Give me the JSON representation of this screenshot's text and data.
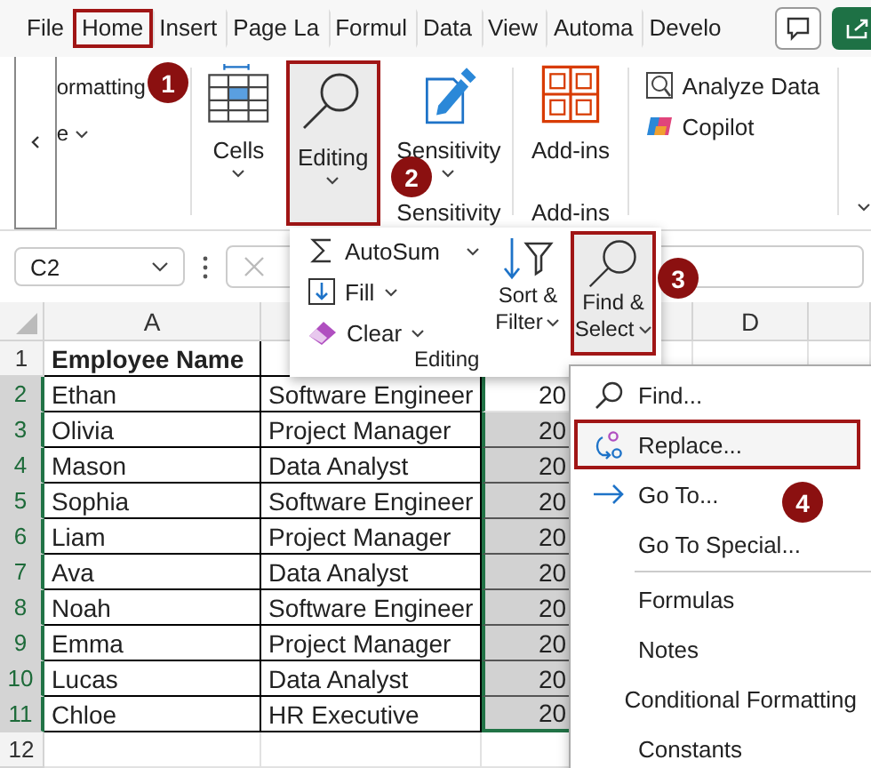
{
  "tabs": [
    {
      "label": "File",
      "selected": false
    },
    {
      "label": "Home",
      "selected": true
    },
    {
      "label": "Insert",
      "selected": false
    },
    {
      "label": "Page La",
      "selected": false
    },
    {
      "label": "Formul",
      "selected": false
    },
    {
      "label": "Data",
      "selected": false
    },
    {
      "label": "View",
      "selected": false
    },
    {
      "label": "Automa",
      "selected": false
    },
    {
      "label": "Develo",
      "selected": false
    }
  ],
  "ribbon": {
    "partial_group": {
      "line_1": "ormatting",
      "line_2": "e"
    },
    "cells": {
      "label": "Cells"
    },
    "editing": {
      "label": "Editing",
      "pressed": true
    },
    "sensitivity": {
      "label": "Sensitivity",
      "group_label": "Sensitivity"
    },
    "addins": {
      "label": "Add-ins",
      "group_label": "Add-ins"
    },
    "commands": [
      {
        "kind": "analyze",
        "label": "Analyze Data"
      },
      {
        "kind": "copilot",
        "label": "Copilot"
      }
    ]
  },
  "formula_bar": {
    "name_box": "C2"
  },
  "grid": {
    "column_headers": {
      "a": "A",
      "d": "D"
    },
    "header_row": {
      "number": "1",
      "name": "Employee Name"
    },
    "rows": [
      {
        "number": "2",
        "name": "Ethan",
        "role": "Software Engineer",
        "value": "20",
        "selected": true,
        "active": true
      },
      {
        "number": "3",
        "name": "Olivia",
        "role": "Project Manager",
        "value": "20",
        "selected": true,
        "active": false
      },
      {
        "number": "4",
        "name": "Mason",
        "role": "Data Analyst",
        "value": "20",
        "selected": true,
        "active": false
      },
      {
        "number": "5",
        "name": "Sophia",
        "role": "Software Engineer",
        "value": "20",
        "selected": true,
        "active": false
      },
      {
        "number": "6",
        "name": "Liam",
        "role": "Project Manager",
        "value": "20",
        "selected": true,
        "active": false
      },
      {
        "number": "7",
        "name": "Ava",
        "role": "Data Analyst",
        "value": "20",
        "selected": true,
        "active": false
      },
      {
        "number": "8",
        "name": "Noah",
        "role": "Software Engineer",
        "value": "20",
        "selected": true,
        "active": false
      },
      {
        "number": "9",
        "name": "Emma",
        "role": "Project Manager",
        "value": "20",
        "selected": true,
        "active": false
      },
      {
        "number": "10",
        "name": "Lucas",
        "role": "Data Analyst",
        "value": "20",
        "selected": true,
        "active": false
      },
      {
        "number": "11",
        "name": "Chloe",
        "role": "HR Executive",
        "value": "20",
        "selected": true,
        "active": false
      }
    ],
    "empty_row": {
      "number": "12"
    }
  },
  "editing_panel": {
    "items": [
      {
        "kind": "sum",
        "label": "AutoSum"
      },
      {
        "kind": "fill",
        "label": "Fill"
      },
      {
        "kind": "clear",
        "label": "Clear"
      }
    ],
    "sort_filter": {
      "line_1": "Sort &",
      "line_2": "Filter"
    },
    "find_select": {
      "line_1": "Find &",
      "line_2": "Select",
      "pressed": true
    },
    "group_label": "Editing"
  },
  "find_menu": {
    "commands": [
      {
        "kind": "find",
        "label": "Find...",
        "highlighted": false
      },
      {
        "kind": "replace",
        "label": "Replace...",
        "highlighted": true
      },
      {
        "kind": "goto",
        "label": "Go To...",
        "highlighted": false
      },
      {
        "kind": "plain",
        "label": "Go To Special...",
        "highlighted": false
      }
    ],
    "selections": [
      {
        "label": "Formulas"
      },
      {
        "label": "Notes"
      },
      {
        "label": "Conditional Formatting"
      },
      {
        "label": "Constants"
      }
    ]
  },
  "callouts": [
    {
      "number": "1"
    },
    {
      "number": "2"
    },
    {
      "number": "3"
    },
    {
      "number": "4"
    }
  ]
}
